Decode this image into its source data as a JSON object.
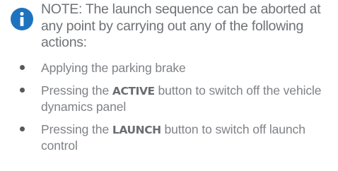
{
  "note": {
    "icon": "info-icon",
    "icon_color": "#1e73be",
    "text": "NOTE: The launch sequence can be aborted at any point by carrying out any of the following actions:"
  },
  "actions": [
    {
      "before": "Applying the parking brake",
      "emph": "",
      "after": ""
    },
    {
      "before": "Pressing the ",
      "emph": "ACTIVE",
      "after": " button to switch off the vehicle dynamics panel"
    },
    {
      "before": "Pressing the ",
      "emph": "LAUNCH",
      "after": " button to switch off launch control"
    }
  ]
}
